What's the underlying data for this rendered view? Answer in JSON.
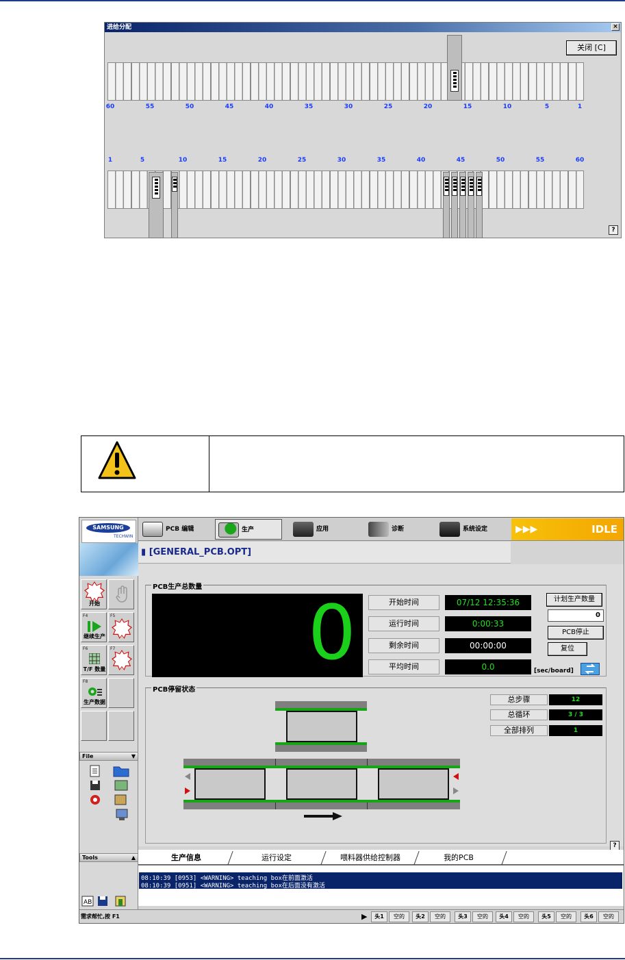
{
  "feeder_dialog": {
    "title": "进给分配",
    "close_label": "关闭 [C]",
    "top_numbers": [
      "60",
      "55",
      "50",
      "45",
      "40",
      "35",
      "30",
      "25",
      "20",
      "15",
      "10",
      "5",
      "1"
    ],
    "bottom_numbers": [
      "1",
      "5",
      "10",
      "15",
      "20",
      "25",
      "30",
      "35",
      "40",
      "45",
      "50",
      "55",
      "60"
    ],
    "help": "?"
  },
  "app": {
    "brand": "SAMSUNG",
    "brand_sub": "TECHWIN",
    "menu": {
      "pcb_edit": "PCB 编辑",
      "production": "生产",
      "application": "应用",
      "diagnosis": "诊断",
      "settings": "系统设定"
    },
    "status_state": "IDLE",
    "status_arrows": "▶▶▶",
    "file_title": "[GENERAL_PCB.OPT]",
    "fkeys": {
      "f4_id": "F4",
      "f4_label": "继续生产",
      "f5_id": "F5",
      "f6_id": "F6",
      "f6_label": "T/F 数量",
      "f7_id": "F7",
      "f8_id": "F8",
      "f8_label": "生产数据",
      "start_label": "开始"
    },
    "file_panel": "File",
    "tools_panel": "Tools",
    "total_group": "PCB生产总数量",
    "total_count": "0",
    "info": {
      "start_time_label": "开始时间",
      "start_time": "07/12 12:35:36",
      "run_time_label": "运行时间",
      "run_time": "0:00:33",
      "remain_time_label": "剩余时间",
      "remain_time": "00:00:00",
      "avg_time_label": "平均时间",
      "avg_time": "0.0",
      "unit": "[sec/board]"
    },
    "plan_label": "计划生产数量",
    "plan_value": "0",
    "pcb_stop": "PCB停止",
    "reset": "复位",
    "stay_group": "PCB停留状态",
    "steps": {
      "total_steps_label": "总步骤",
      "total_steps": "12",
      "total_cycle_label": "总循环",
      "total_cycle": "3 / 3",
      "all_array_label": "全部排列",
      "all_array": "1"
    },
    "tabs": [
      "生产信息",
      "运行设定",
      "喂料器供给控制器",
      "我的PCB"
    ],
    "log": [
      "08:10:39 [0953] <WARNING> teaching box在前面激活",
      "08:10:39 [0951] <WARNING> teaching box在后面没有激活"
    ],
    "status_text": "需求帮忙,按 F1",
    "heads": [
      {
        "h": "头1",
        "v": "空的"
      },
      {
        "h": "头2",
        "v": "空的"
      },
      {
        "h": "头3",
        "v": "空的"
      },
      {
        "h": "头4",
        "v": "空的"
      },
      {
        "h": "头5",
        "v": "空的"
      },
      {
        "h": "头6",
        "v": "空的"
      }
    ],
    "help": "?"
  }
}
